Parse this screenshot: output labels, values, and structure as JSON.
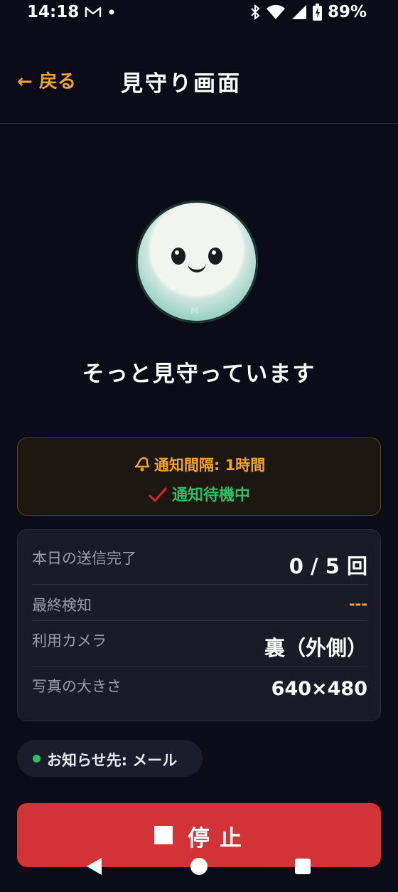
{
  "status_bar": {
    "time": "14:18",
    "battery": "89%",
    "icons": [
      "gmail-icon",
      "dot-icon",
      "bluetooth-icon",
      "wifi-icon",
      "signal-icon",
      "battery-charging-icon"
    ]
  },
  "header": {
    "back_label": "← 戻る",
    "title": "見守り画面"
  },
  "main": {
    "status_text": "そっと見守っています",
    "avatar_badge": "M"
  },
  "notify": {
    "interval": "通知間隔: 1時間",
    "waiting": "通知待機中",
    "colors": {
      "accent": "#f0a42a",
      "ok": "#2fbf63"
    }
  },
  "info": {
    "rows": [
      {
        "label": "本日の送信完了",
        "value": "0 / 5 回"
      },
      {
        "label": "最終検知",
        "value": "---"
      },
      {
        "label": "利用カメラ",
        "value": "裏（外側）"
      },
      {
        "label": "写真の大きさ",
        "value": "640×480"
      }
    ]
  },
  "destination": {
    "label": "お知らせ先: メール"
  },
  "stop_button": {
    "label": "停止",
    "color": "#d33236"
  },
  "nav": {
    "icons": [
      "back-triangle-icon",
      "home-circle-icon",
      "recents-square-icon"
    ]
  }
}
